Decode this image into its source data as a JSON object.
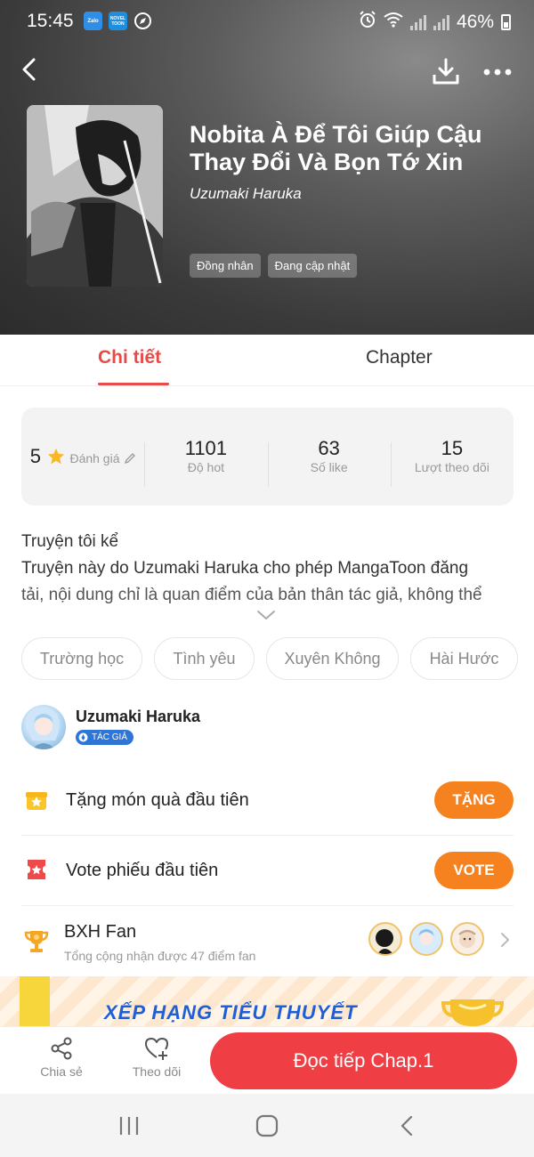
{
  "status_bar": {
    "time": "15:45",
    "apps": [
      "Zalo",
      "NOVEL TOON"
    ],
    "battery": "46%"
  },
  "header": {
    "title": "Nobita À Để Tôi Giúp Cậu Thay Đổi Và Bọn Tớ Xin",
    "author": "Uzumaki Haruka",
    "tags": [
      "Đồng nhân",
      "Đang cập nhật"
    ]
  },
  "tabs": [
    {
      "label": "Chi tiết",
      "active": true
    },
    {
      "label": "Chapter",
      "active": false
    }
  ],
  "stats": [
    {
      "value": "5",
      "label": "Đánh giá"
    },
    {
      "value": "1101",
      "label": "Độ hot"
    },
    {
      "value": "63",
      "label": "Số like"
    },
    {
      "value": "15",
      "label": "Lượt theo dõi"
    }
  ],
  "description": {
    "lines": [
      "Truyện tôi kể",
      "Truyện này do Uzumaki Haruka cho phép MangaToon đăng",
      "tải, nội dung chỉ là quan điểm của bản thân tác giả, không thể"
    ]
  },
  "genre_chips": [
    "Trường học",
    "Tình yêu",
    "Xuyên Không",
    "Hài Hước"
  ],
  "author_card": {
    "name": "Uzumaki Haruka",
    "badge": "TÁC GIẢ"
  },
  "gift_row": {
    "label": "Tặng món quà đầu tiên",
    "button": "TẶNG"
  },
  "vote_row": {
    "label": "Vote phiếu đầu tiên",
    "button": "VOTE"
  },
  "fan_rank": {
    "title": "BXH Fan",
    "subtitle": "Tổng cộng nhận được 47 điểm fan"
  },
  "banner": {
    "text": "XẾP HẠNG TIỂU THUYẾT"
  },
  "bottom_bar": {
    "share_label": "Chia sẻ",
    "follow_label": "Theo dõi",
    "read_button": "Đọc tiếp Chap.1"
  },
  "colors": {
    "accent_red": "#e84a47",
    "orange_button": "#f5821f",
    "read_button": "#ef3f45",
    "badge_blue": "#2d76d8"
  }
}
